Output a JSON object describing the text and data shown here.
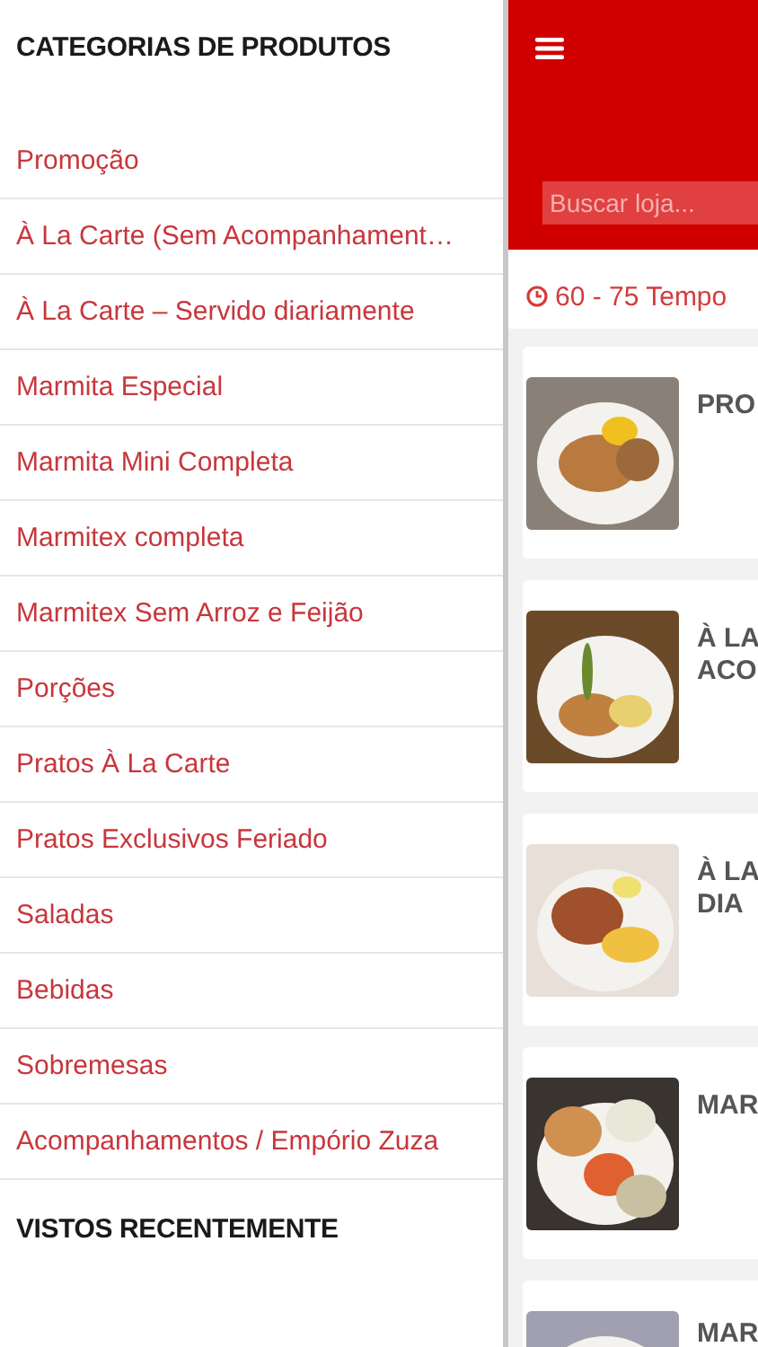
{
  "drawer": {
    "title": "CATEGORIAS DE PRODUTOS",
    "items": [
      {
        "label": "Promoção"
      },
      {
        "label": "À La Carte (Sem Acompanhament…"
      },
      {
        "label": "À La Carte – Servido diariamente"
      },
      {
        "label": "Marmita Especial"
      },
      {
        "label": "Marmita Mini Completa"
      },
      {
        "label": "Marmitex completa"
      },
      {
        "label": "Marmitex Sem Arroz e Feijão"
      },
      {
        "label": "Porções"
      },
      {
        "label": "Pratos À La Carte"
      },
      {
        "label": "Pratos Exclusivos Feriado"
      },
      {
        "label": "Saladas"
      },
      {
        "label": "Bebidas"
      },
      {
        "label": "Sobremesas"
      },
      {
        "label": "Acompanhamentos / Empório Zuza"
      }
    ],
    "recent_title": "VISTOS RECENTEMENTE"
  },
  "main": {
    "search": {
      "placeholder": "Buscar loja..."
    },
    "delivery_time": "60 - 75 Tempo",
    "cards": [
      {
        "title_lines": [
          "PRO"
        ],
        "picture": {
          "kind": "picture"
        }
      },
      {
        "title_lines": [
          "À LA",
          "ACO"
        ],
        "picture": {
          "kind": "picture"
        }
      },
      {
        "title_lines": [
          "À LA",
          "DIA"
        ],
        "picture": {
          "kind": "picture"
        }
      },
      {
        "title_lines": [
          "MAR"
        ],
        "picture": {
          "kind": "picture"
        }
      },
      {
        "title_lines": [
          "MAR"
        ],
        "picture": {
          "kind": "picture"
        }
      }
    ]
  }
}
